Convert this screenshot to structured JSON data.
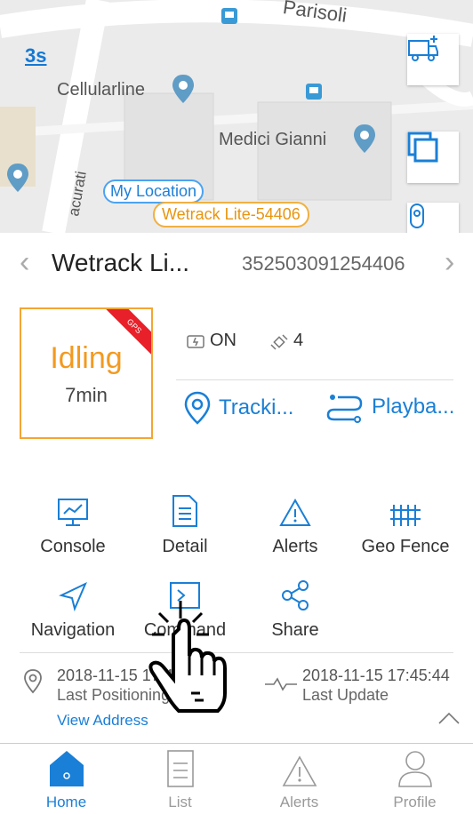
{
  "map": {
    "zoom_label": "3s",
    "street_top": "Parisoli",
    "street_side": "acurati",
    "places": [
      "Cellularline",
      "Medici Gianni"
    ],
    "my_location": "My Location",
    "device_tag": "Wetrack Lite-54406"
  },
  "device": {
    "name": "Wetrack Li...",
    "imei": "352503091254406"
  },
  "status": {
    "state": "Idling",
    "duration": "7min",
    "corner_badge": "GPS"
  },
  "info": {
    "acc": "ON",
    "satellites": "4"
  },
  "actions": {
    "tracking": "Tracki...",
    "playback": "Playba..."
  },
  "grid": {
    "console": "Console",
    "detail": "Detail",
    "alerts": "Alerts",
    "geo_fence": "Geo Fence",
    "navigation": "Navigation",
    "command": "Command",
    "share": "Share"
  },
  "times": {
    "positioning_time": "2018-11-15 17:40:32",
    "positioning_label": "Last Positioning",
    "update_time": "2018-11-15 17:45:44",
    "update_label": "Last Update",
    "view_address": "View Address"
  },
  "tabs": {
    "home": "Home",
    "list": "List",
    "alerts": "Alerts",
    "profile": "Profile"
  },
  "colors": {
    "accent": "#1a7fd6",
    "status": "#f39a1f",
    "badge": "#e8202a"
  }
}
